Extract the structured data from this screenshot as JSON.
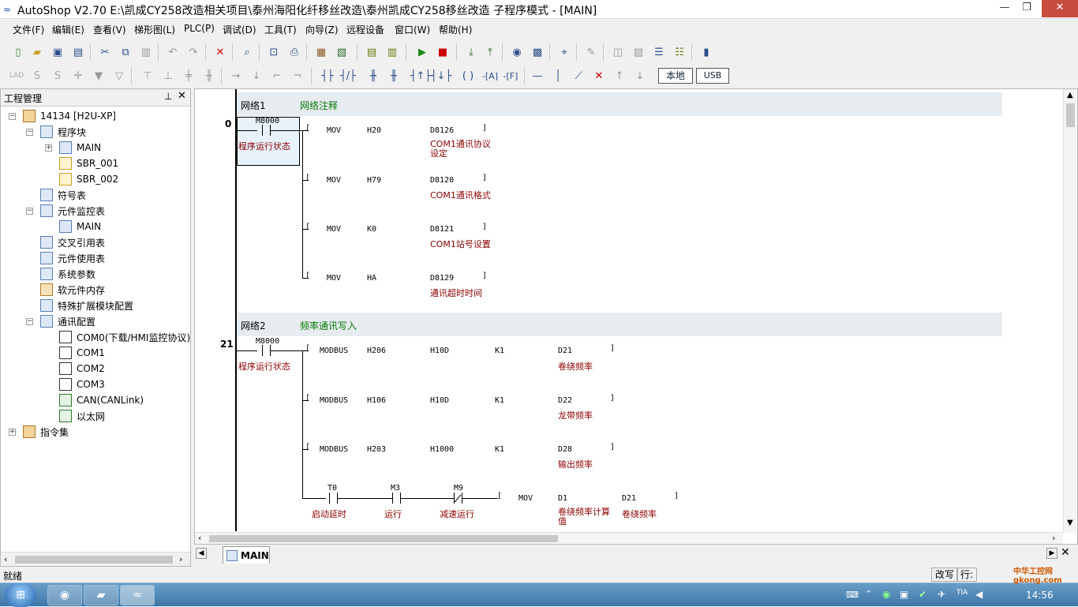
{
  "window": {
    "title": "AutoShop V2.70  E:\\凯成CY258改造相关项目\\泰州海阳化纤移丝改造\\泰州凯成CY258移丝改造 子程序模式 - [MAIN]"
  },
  "menu": [
    "文件(F)",
    "编辑(E)",
    "查看(V)",
    "梯形图(L)",
    "PLC(P)",
    "调试(D)",
    "工具(T)",
    "向导(Z)",
    "远程设备",
    "窗口(W)",
    "帮助(H)"
  ],
  "toolbar2": {
    "local_label": "本地",
    "usb_label": "USB"
  },
  "project_pane": {
    "title": "工程管理",
    "tree": [
      {
        "label": "14134 [H2U-XP]",
        "icon": "plc-icon"
      },
      {
        "label": "程序块",
        "icon": "program-block-icon"
      },
      {
        "label": "MAIN",
        "icon": "program-icon"
      },
      {
        "label": "SBR_001",
        "icon": "subroutine-icon"
      },
      {
        "label": "SBR_002",
        "icon": "subroutine-icon"
      },
      {
        "label": "符号表",
        "icon": "symbol-table-icon"
      },
      {
        "label": "元件监控表",
        "icon": "monitor-table-icon"
      },
      {
        "label": "MAIN",
        "icon": "monitor-icon"
      },
      {
        "label": "交叉引用表",
        "icon": "cross-ref-icon"
      },
      {
        "label": "元件使用表",
        "icon": "usage-table-icon"
      },
      {
        "label": "系统参数",
        "icon": "system-params-icon"
      },
      {
        "label": "软元件内存",
        "icon": "device-memory-icon"
      },
      {
        "label": "特殊扩展模块配置",
        "icon": "expansion-module-icon"
      },
      {
        "label": "通讯配置",
        "icon": "comm-config-icon"
      },
      {
        "label": "COM0(下载/HMI监控协议)",
        "icon": "com-port-icon"
      },
      {
        "label": "COM1",
        "icon": "com-port-icon"
      },
      {
        "label": "COM2",
        "icon": "com-port-icon"
      },
      {
        "label": "COM3",
        "icon": "com-port-icon"
      },
      {
        "label": "CAN(CANLink)",
        "icon": "can-icon"
      },
      {
        "label": "以太网",
        "icon": "ethernet-icon"
      },
      {
        "label": "指令集",
        "icon": "instruction-set-icon"
      }
    ]
  },
  "ladder": {
    "networks": [
      {
        "name": "网络1",
        "comment": "网络注释",
        "step": "0",
        "contact": {
          "addr": "M8000",
          "comment": "程序运行状态"
        },
        "rungs": [
          {
            "op": "MOV",
            "a": "H20",
            "b": "D8126",
            "c_comment": "COM1通讯协议设定"
          },
          {
            "op": "MOV",
            "a": "H79",
            "b": "D8120",
            "c_comment": "COM1通讯格式"
          },
          {
            "op": "MOV",
            "a": "K0",
            "b": "D8121",
            "c_comment": "COM1站号设置"
          },
          {
            "op": "MOV",
            "a": "HA",
            "b": "D8129",
            "c_comment": "通讯超时时间"
          }
        ]
      },
      {
        "name": "网络2",
        "comment": "频率通讯写入",
        "step": "21",
        "contact": {
          "addr": "M8000",
          "comment": "程序运行状态"
        },
        "rungs": [
          {
            "op": "MODBUS",
            "a": "H206",
            "b": "H10D",
            "c": "K1",
            "d": "D21",
            "d_comment": "卷绕频率"
          },
          {
            "op": "MODBUS",
            "a": "H106",
            "b": "H10D",
            "c": "K1",
            "d": "D22",
            "d_comment": "龙带频率"
          },
          {
            "op": "MODBUS",
            "a": "H203",
            "b": "H1000",
            "c": "K1",
            "d": "D28",
            "d_comment": "输出频率"
          }
        ],
        "series_rung": {
          "contacts": [
            {
              "addr": "T0",
              "comment": "启动延时"
            },
            {
              "addr": "M3",
              "comment": "运行"
            },
            {
              "addr": "M9",
              "comment": "减速运行"
            }
          ],
          "op": "MOV",
          "a": "D1",
          "a_comment": "卷绕频率计算值",
          "b": "D21",
          "b_comment": "卷绕频率"
        }
      }
    ]
  },
  "tabs": {
    "active": "MAIN"
  },
  "status": {
    "left": "就绪",
    "mode": "改写",
    "row_label": "行:"
  },
  "taskbar": {
    "time": "14:56",
    "watermark": "中华工控网 gkong.com"
  }
}
